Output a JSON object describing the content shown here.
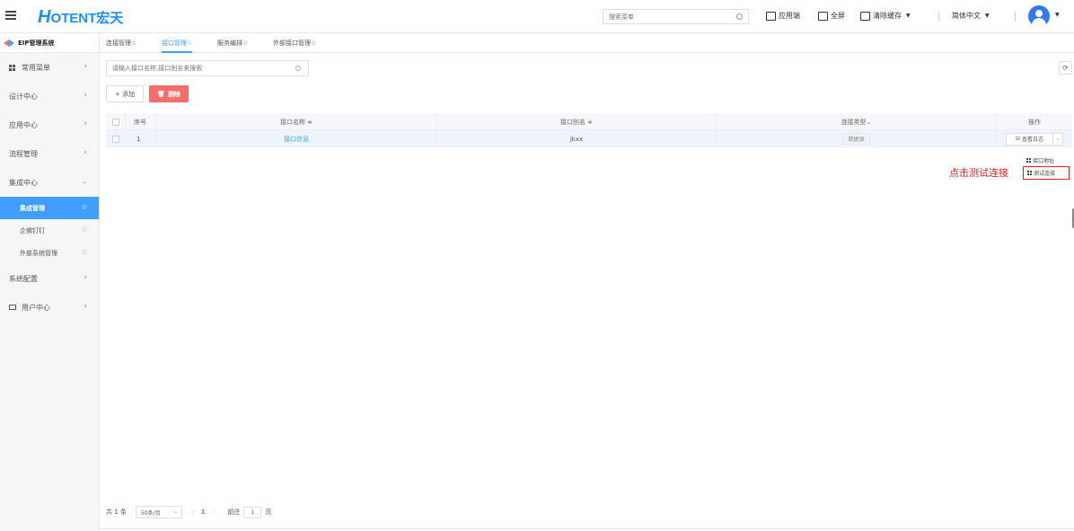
{
  "header": {
    "logo_mark": "H",
    "logo_text": "OTENT宏天",
    "search_placeholder": "搜索菜单",
    "app_end": "应用端",
    "fullscreen": "全屏",
    "clear_cache": "清除缓存",
    "language": "简体中文"
  },
  "sidebar": {
    "system_title": "EIP管理系统",
    "items": [
      {
        "label": "常用菜单"
      },
      {
        "label": "设计中心"
      },
      {
        "label": "应用中心"
      },
      {
        "label": "流程管理"
      },
      {
        "label": "集成中心"
      },
      {
        "label": "集成管理"
      },
      {
        "label": "企微钉钉"
      },
      {
        "label": "外部系统管理"
      },
      {
        "label": "系统配置"
      },
      {
        "label": "用户中心"
      }
    ]
  },
  "tabs": [
    {
      "label": "连接管理☆"
    },
    {
      "label": "接口管理☆"
    },
    {
      "label": "服务编排☆"
    },
    {
      "label": "外部接口管理☆"
    }
  ],
  "toolbar": {
    "search_placeholder": "请输入接口名称,接口别名来搜索",
    "add_label": "+ 添加",
    "delete_label": "删除"
  },
  "table": {
    "columns": [
      "序号",
      "接口名称 ≑",
      "接口别名 ≑",
      "连接类型⌄",
      "操作"
    ],
    "rows": [
      {
        "index": "1",
        "name": "接口信息",
        "alias": "jkxx",
        "type": "数据源",
        "action": "查看日志"
      }
    ]
  },
  "dropdown": {
    "items": [
      "接口地址",
      "测试连接"
    ]
  },
  "annotation": "点击测试连接",
  "pagination": {
    "total": "共 1 条",
    "page_size": "50条/页",
    "current_page": "1",
    "goto_label": "前往",
    "goto_value": "1",
    "page_unit": "页"
  }
}
